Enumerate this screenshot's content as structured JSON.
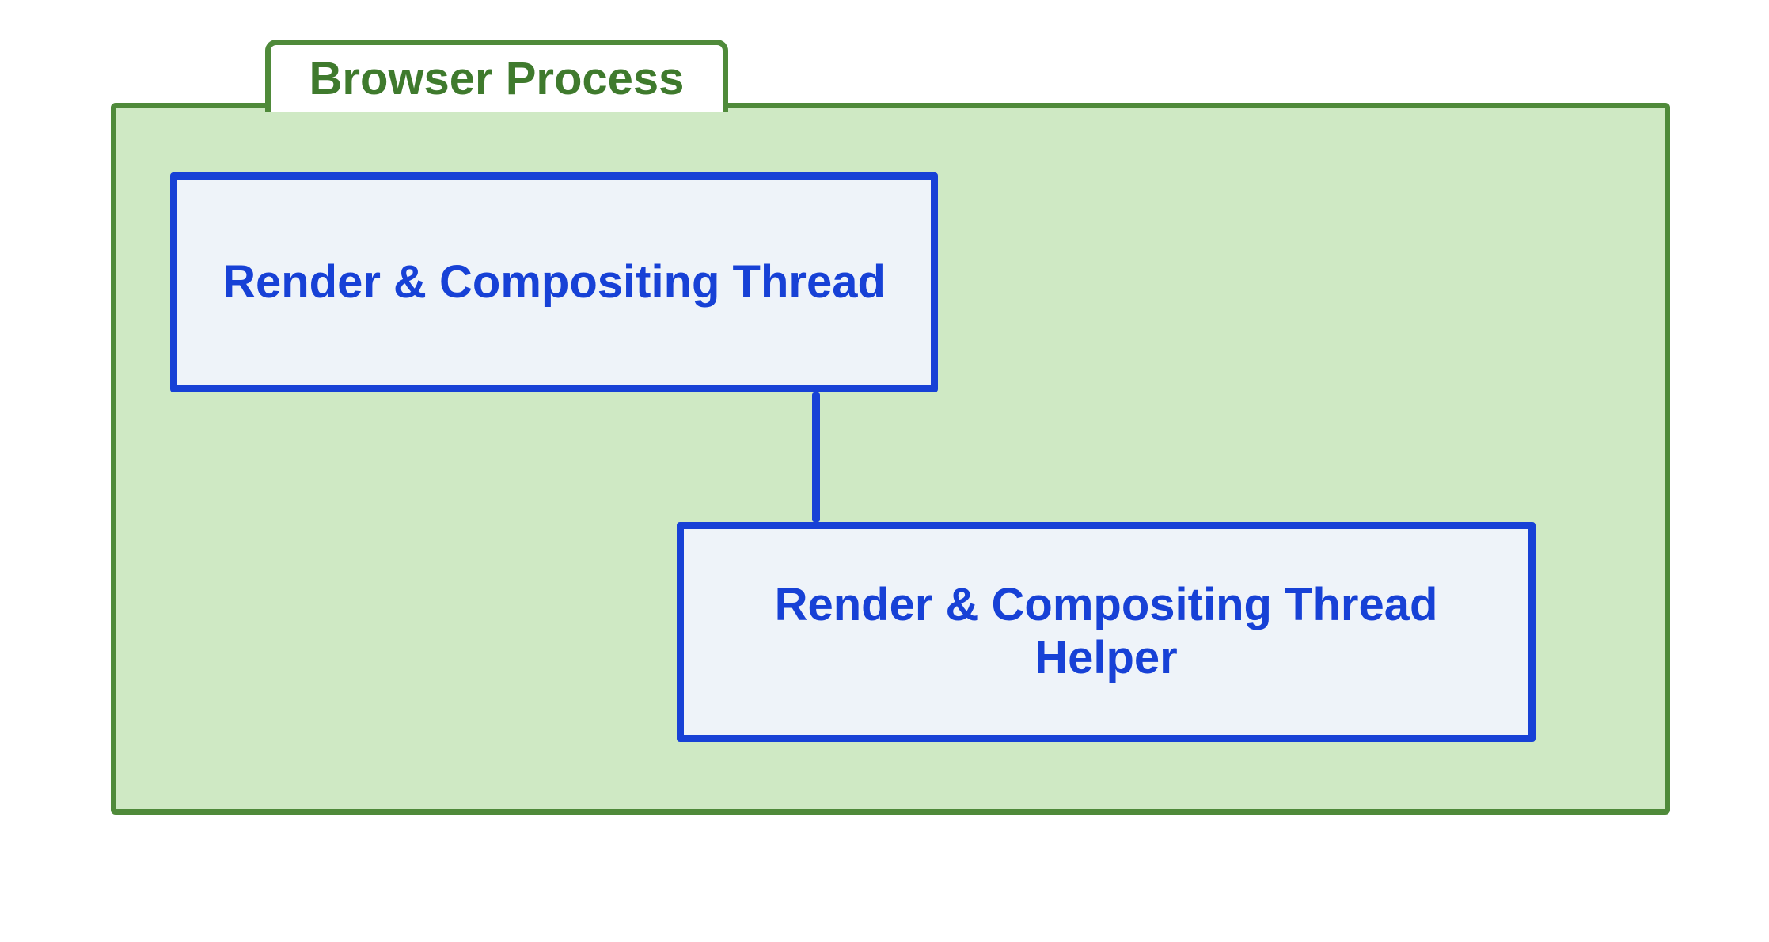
{
  "process": {
    "title": "Browser Process",
    "threads": {
      "render_compositing": "Render & Compositing Thread",
      "render_compositing_helper": "Render & Compositing Thread Helper"
    }
  },
  "colors": {
    "process_border": "#4f8a3a",
    "process_fill": "#cfe9c4",
    "thread_border": "#1741d6",
    "thread_fill": "#eef3f9"
  }
}
